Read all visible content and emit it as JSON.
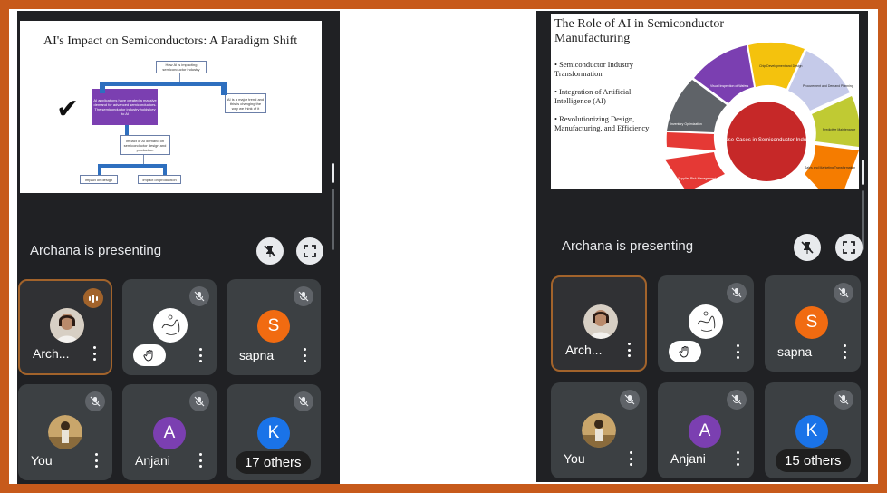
{
  "left": {
    "slide": {
      "title": "AI's Impact on Semiconductors: A Paradigm Shift",
      "boxes": {
        "top": "How AI is impacting semiconductor industry",
        "left": "AI applications have created a massive demand for advanced semiconductors. The semiconductor industry holds key to AI",
        "right": "AI is a major trend and this is changing the way we think of it",
        "middle": "Impact of AI demand on semiconductor design and production",
        "bottom_left": "Impact on design",
        "bottom_right": "Impact on production"
      },
      "checkmark": "✔"
    },
    "presenting_text": "Archana is presenting",
    "tiles": [
      {
        "name": "Arch...",
        "kind": "photo",
        "speaking": true
      },
      {
        "name": "",
        "kind": "logo",
        "hand_raised": true,
        "muted": true
      },
      {
        "name": "sapna",
        "kind": "letter",
        "letter": "S",
        "color": "#f16b11",
        "muted": true
      },
      {
        "name": "You",
        "kind": "photo2",
        "muted": true
      },
      {
        "name": "Anjani",
        "kind": "letter",
        "letter": "A",
        "color": "#7b3fb1",
        "muted": true
      },
      {
        "name": "K",
        "kind": "letter",
        "letter": "K",
        "color": "#1a73e8",
        "muted": true,
        "others": "17 others"
      }
    ]
  },
  "right": {
    "slide": {
      "title": "The Role of AI in Semiconductor Manufacturing",
      "bullets": [
        "• Semiconductor Industry Transformation",
        "• Integration of Artificial Intelligence (AI)",
        "• Revolutionizing Design, Manufacturing, and Efficiency"
      ],
      "center": "AI Use Cases in Semiconductor Industry",
      "segments": [
        "Supplier Risk Management",
        "Inventory Optimization",
        "Visual Inspection of Wafers",
        "Chip Development and Design",
        "Procurement and Demand Planning",
        "Predictive Maintenance",
        "Sales and Marketing Transformation"
      ]
    },
    "presenting_text": "Archana is presenting",
    "tiles": [
      {
        "name": "Arch...",
        "kind": "photo"
      },
      {
        "name": "",
        "kind": "logo",
        "hand_raised": true,
        "muted": true
      },
      {
        "name": "sapna",
        "kind": "letter",
        "letter": "S",
        "color": "#f16b11",
        "muted": true
      },
      {
        "name": "You",
        "kind": "photo2",
        "muted": true
      },
      {
        "name": "Anjani",
        "kind": "letter",
        "letter": "A",
        "color": "#7b3fb1",
        "muted": true
      },
      {
        "name": "K",
        "kind": "letter",
        "letter": "K",
        "color": "#1a73e8",
        "muted": true,
        "others": "15 others"
      }
    ]
  }
}
